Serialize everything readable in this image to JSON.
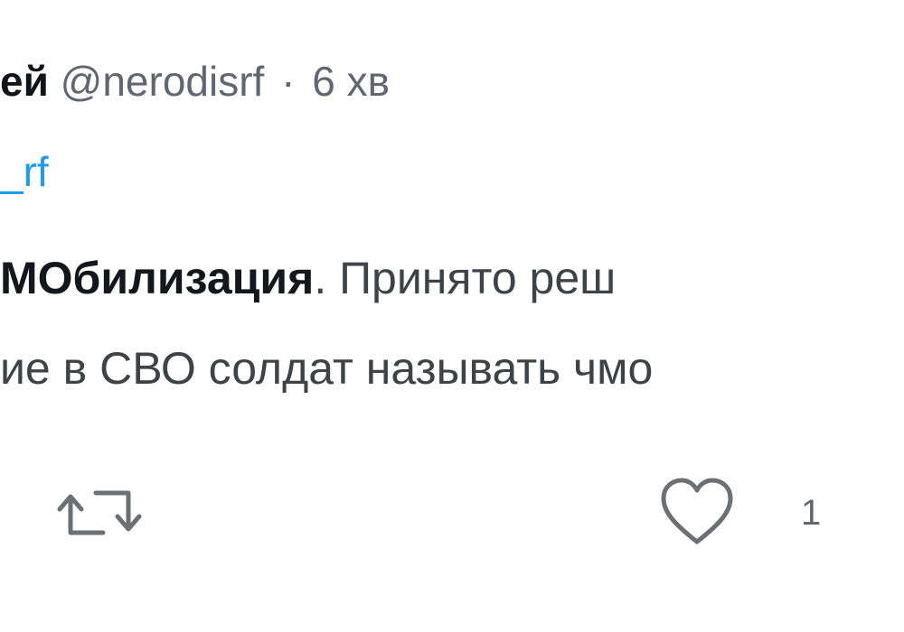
{
  "tweet": {
    "author_name": "ей",
    "handle": "@nerodisrf",
    "separator": "·",
    "time": "6 хв",
    "reply_to": "_rf",
    "body": {
      "line1_bold": "МОбилизация",
      "line1_rest": ". Принято реш",
      "line2": "ие в СВО солдат называть чмо"
    },
    "actions": {
      "retweet_icon": "retweet-icon",
      "like_icon": "heart-icon",
      "like_count": "1"
    }
  },
  "colors": {
    "link": "#1d9bf0",
    "muted": "#606770",
    "text": "#0f1419"
  }
}
